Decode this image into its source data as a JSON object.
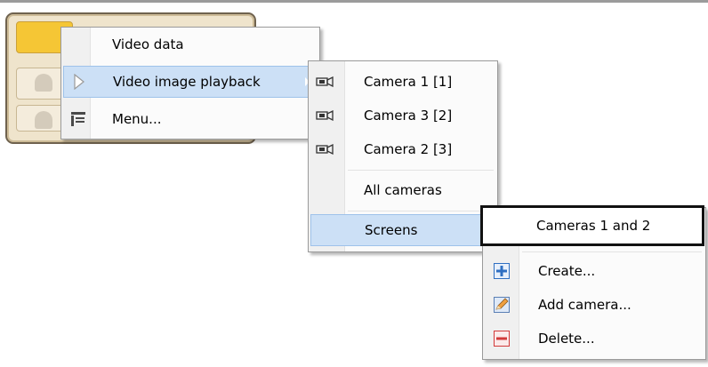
{
  "colors": {
    "highlight_bg": "#cce0f6",
    "highlight_border": "#9ec2ea",
    "panel_bg": "#efe4cc",
    "panel_accent": "#f5c635",
    "plus_blue": "#2f6fc2",
    "minus_red": "#d23a3a"
  },
  "menu1": {
    "items": [
      {
        "label": "Video data",
        "icon": ""
      },
      {
        "label": "Video image playback",
        "icon": "play-icon",
        "highlighted": true,
        "submenu": true
      },
      {
        "label": "Menu...",
        "icon": "menu-icon"
      }
    ]
  },
  "menu2": {
    "items": [
      {
        "label": "Camera 1 [1]",
        "icon": "camera-icon"
      },
      {
        "label": "Camera 3 [2]",
        "icon": "camera-icon"
      },
      {
        "label": "Camera 2 [3]",
        "icon": "camera-icon"
      },
      {
        "label": "All cameras",
        "icon": ""
      },
      {
        "label": "Screens",
        "icon": "",
        "highlighted": true,
        "submenu": true
      }
    ]
  },
  "menu3": {
    "items": [
      {
        "label": "Cameras 1 and 2",
        "icon": "",
        "outlined": true
      },
      {
        "label": "Create...",
        "icon": "plus-icon"
      },
      {
        "label": "Add camera...",
        "icon": "edit-icon"
      },
      {
        "label": "Delete...",
        "icon": "minus-icon"
      }
    ]
  }
}
